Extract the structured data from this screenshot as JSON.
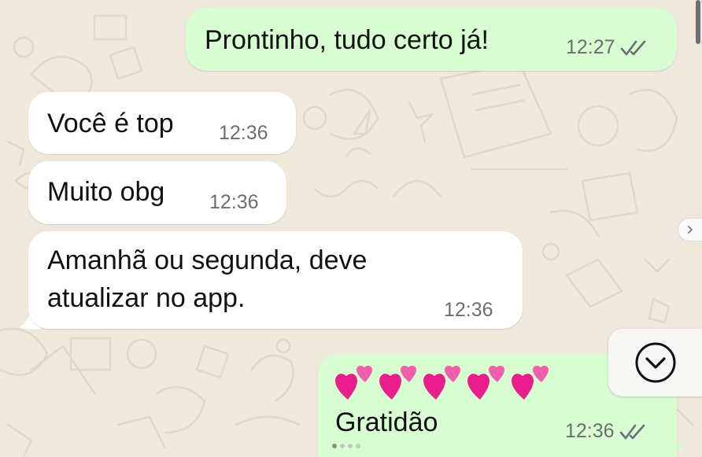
{
  "messages": [
    {
      "direction": "outgoing",
      "text": "Prontinho, tudo certo já!",
      "time": "12:27",
      "status": "read"
    },
    {
      "direction": "incoming",
      "text": "Você é top",
      "time": "12:36"
    },
    {
      "direction": "incoming",
      "text": "Muito obg",
      "time": "12:36"
    },
    {
      "direction": "incoming",
      "lines": [
        "Amanhã ou segunda, deve",
        "atualizar no app."
      ],
      "time": "12:36"
    },
    {
      "direction": "outgoing",
      "emoji": "💕💕💕💕💕",
      "text": "Gratidão",
      "time": "12:36",
      "status": "read"
    }
  ],
  "colors": {
    "incoming": "#ffffff",
    "outgoing": "#d9fdd3",
    "wallpaper": "#efe9dd",
    "ticks": "#6b6f72",
    "hearts": "#e91e8c"
  },
  "icons": {
    "scroll_down": "chevron-down-circle-icon",
    "read_receipt": "double-check-icon",
    "side_arrow": "chevron-right-icon"
  }
}
